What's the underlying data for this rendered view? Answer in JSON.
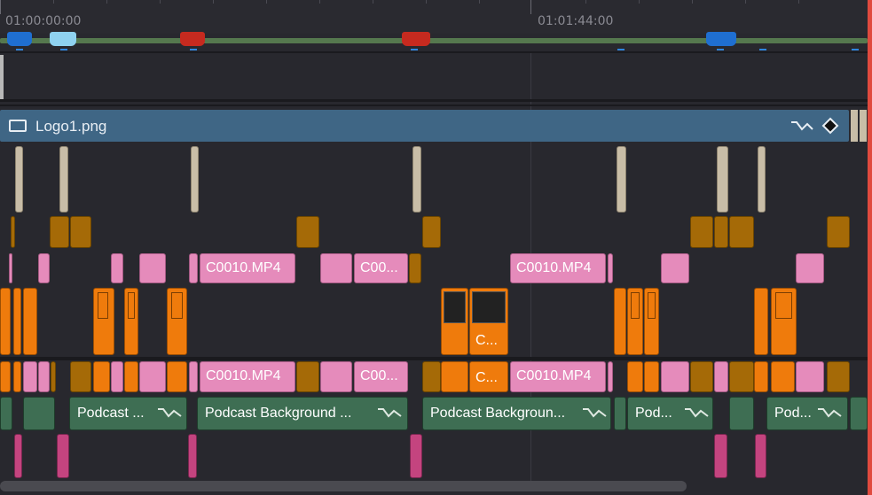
{
  "ruler": {
    "tc_start": "01:00:00:00",
    "tc_mid": "01:01:44:00"
  },
  "video_track_header": {
    "clip_name": "Logo1.png",
    "icon": "image-icon",
    "curve_icon": "curve-icon",
    "keyframe_icon": "keyframe-icon"
  },
  "clips": {
    "c0010": "C0010.MP4",
    "c00": "C00...",
    "c_short": "C...",
    "podcast_short": "Podcast ...",
    "podcast_bg": "Podcast Background ...",
    "podcast_bg2": "Podcast Backgroun...",
    "pod": "Pod...",
    "pod2": "Pod..."
  },
  "colors": {
    "playhead": "#e04a3e",
    "video_title": "#3f6685",
    "pink": "#e58bbb",
    "orange": "#ef7b0c",
    "gold": "#a56a07",
    "green": "#3e6e53",
    "magenta": "#c4447f"
  }
}
